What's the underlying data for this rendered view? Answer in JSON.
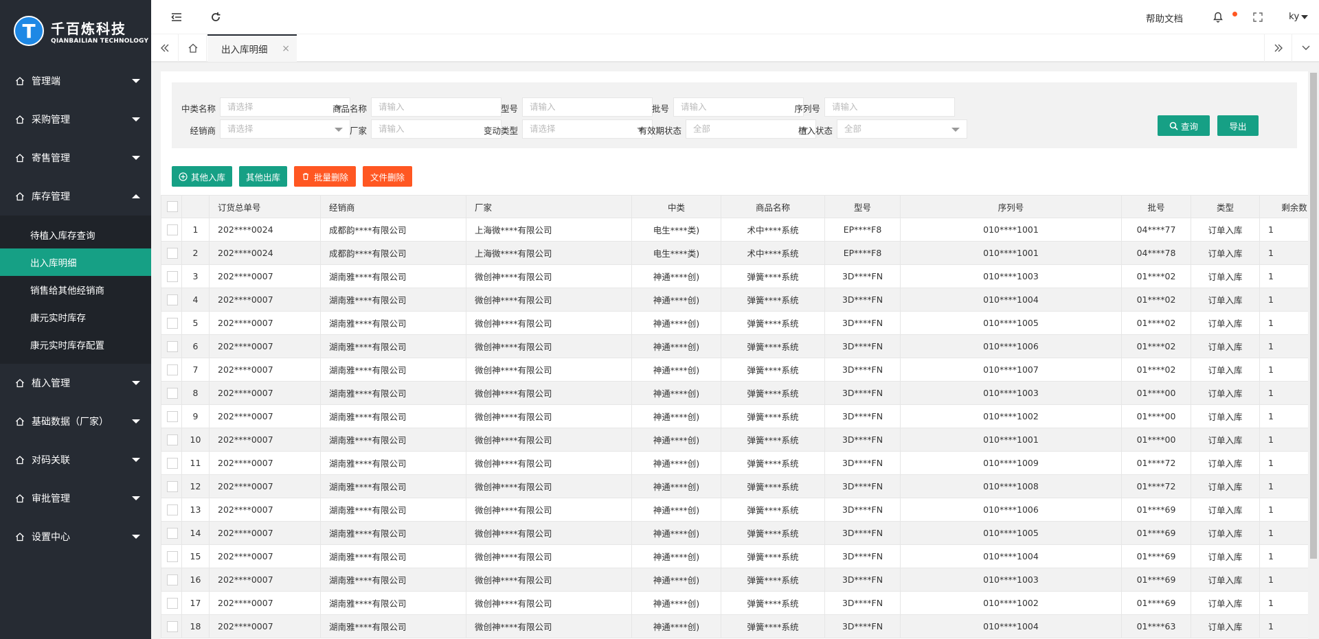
{
  "brand": {
    "logo_char": "T",
    "name_cn": "千百炼科技",
    "name_en": "QIANBAILIAN TECHNOLOGY"
  },
  "sidebar": {
    "items": [
      {
        "label": "管理端",
        "expanded": false
      },
      {
        "label": "采购管理",
        "expanded": false
      },
      {
        "label": "寄售管理",
        "expanded": false
      },
      {
        "label": "库存管理",
        "expanded": true
      },
      {
        "label": "植入管理",
        "expanded": false
      },
      {
        "label": "基础数据（厂家）",
        "expanded": false
      },
      {
        "label": "对码关联",
        "expanded": false
      },
      {
        "label": "审批管理",
        "expanded": false
      },
      {
        "label": "设置中心",
        "expanded": false
      }
    ],
    "submenu": [
      {
        "label": "待植入库存查询",
        "active": false
      },
      {
        "label": "出入库明细",
        "active": true
      },
      {
        "label": "销售给其他经销商",
        "active": false
      },
      {
        "label": "康元实时库存",
        "active": false
      },
      {
        "label": "康元实时库存配置",
        "active": false
      }
    ]
  },
  "header": {
    "help_label": "帮助文档",
    "user": "ky"
  },
  "tabs": {
    "active_label": "出入库明细",
    "close": "×"
  },
  "filters": {
    "row1": [
      {
        "label": "中类名称",
        "placeholder": "请选择",
        "type": "select"
      },
      {
        "label": "商品名称",
        "placeholder": "请输入",
        "type": "input"
      },
      {
        "label": "型号",
        "placeholder": "请输入",
        "type": "input"
      },
      {
        "label": "批号",
        "placeholder": "请输入",
        "type": "input"
      },
      {
        "label": "序列号",
        "placeholder": "请输入",
        "type": "input"
      }
    ],
    "row2": [
      {
        "label": "经销商",
        "placeholder": "请选择",
        "type": "select"
      },
      {
        "label": "厂家",
        "placeholder": "请输入",
        "type": "input"
      },
      {
        "label": "变动类型",
        "placeholder": "请选择",
        "type": "select"
      },
      {
        "label": "有效期状态",
        "placeholder": "全部",
        "type": "select"
      },
      {
        "label": "植入状态",
        "placeholder": "全部",
        "type": "select"
      }
    ],
    "query_label": "查询",
    "export_label": "导出"
  },
  "toolbar": {
    "other_in": "其他入库",
    "other_out": "其他出库",
    "batch_delete": "批量删除",
    "file_delete": "文件删除"
  },
  "table": {
    "columns": [
      "",
      "",
      "订货总单号",
      "经销商",
      "厂家",
      "中类",
      "商品名称",
      "型号",
      "序列号",
      "批号",
      "类型",
      "剩余数"
    ],
    "rows": [
      [
        "1",
        "202****0024",
        "成都韵****有限公司",
        "上海微****有限公司",
        "电生****类)",
        "术中****系统",
        "EP****F8",
        "010****1001",
        "04****77",
        "订单入库",
        "1"
      ],
      [
        "2",
        "202****0024",
        "成都韵****有限公司",
        "上海微****有限公司",
        "电生****类)",
        "术中****系统",
        "EP****F8",
        "010****1001",
        "04****78",
        "订单入库",
        "1"
      ],
      [
        "3",
        "202****0007",
        "湖南雅****有限公司",
        "微创神****有限公司",
        "神通****创)",
        "弹簧****系统",
        "3D****FN",
        "010****1003",
        "01****02",
        "订单入库",
        "1"
      ],
      [
        "4",
        "202****0007",
        "湖南雅****有限公司",
        "微创神****有限公司",
        "神通****创)",
        "弹簧****系统",
        "3D****FN",
        "010****1004",
        "01****02",
        "订单入库",
        "1"
      ],
      [
        "5",
        "202****0007",
        "湖南雅****有限公司",
        "微创神****有限公司",
        "神通****创)",
        "弹簧****系统",
        "3D****FN",
        "010****1005",
        "01****02",
        "订单入库",
        "1"
      ],
      [
        "6",
        "202****0007",
        "湖南雅****有限公司",
        "微创神****有限公司",
        "神通****创)",
        "弹簧****系统",
        "3D****FN",
        "010****1006",
        "01****02",
        "订单入库",
        "1"
      ],
      [
        "7",
        "202****0007",
        "湖南雅****有限公司",
        "微创神****有限公司",
        "神通****创)",
        "弹簧****系统",
        "3D****FN",
        "010****1007",
        "01****02",
        "订单入库",
        "1"
      ],
      [
        "8",
        "202****0007",
        "湖南雅****有限公司",
        "微创神****有限公司",
        "神通****创)",
        "弹簧****系统",
        "3D****FN",
        "010****1003",
        "01****00",
        "订单入库",
        "1"
      ],
      [
        "9",
        "202****0007",
        "湖南雅****有限公司",
        "微创神****有限公司",
        "神通****创)",
        "弹簧****系统",
        "3D****FN",
        "010****1002",
        "01****00",
        "订单入库",
        "1"
      ],
      [
        "10",
        "202****0007",
        "湖南雅****有限公司",
        "微创神****有限公司",
        "神通****创)",
        "弹簧****系统",
        "3D****FN",
        "010****1001",
        "01****00",
        "订单入库",
        "1"
      ],
      [
        "11",
        "202****0007",
        "湖南雅****有限公司",
        "微创神****有限公司",
        "神通****创)",
        "弹簧****系统",
        "3D****FN",
        "010****1009",
        "01****72",
        "订单入库",
        "1"
      ],
      [
        "12",
        "202****0007",
        "湖南雅****有限公司",
        "微创神****有限公司",
        "神通****创)",
        "弹簧****系统",
        "3D****FN",
        "010****1008",
        "01****72",
        "订单入库",
        "1"
      ],
      [
        "13",
        "202****0007",
        "湖南雅****有限公司",
        "微创神****有限公司",
        "神通****创)",
        "弹簧****系统",
        "3D****FN",
        "010****1006",
        "01****69",
        "订单入库",
        "1"
      ],
      [
        "14",
        "202****0007",
        "湖南雅****有限公司",
        "微创神****有限公司",
        "神通****创)",
        "弹簧****系统",
        "3D****FN",
        "010****1005",
        "01****69",
        "订单入库",
        "1"
      ],
      [
        "15",
        "202****0007",
        "湖南雅****有限公司",
        "微创神****有限公司",
        "神通****创)",
        "弹簧****系统",
        "3D****FN",
        "010****1004",
        "01****69",
        "订单入库",
        "1"
      ],
      [
        "16",
        "202****0007",
        "湖南雅****有限公司",
        "微创神****有限公司",
        "神通****创)",
        "弹簧****系统",
        "3D****FN",
        "010****1003",
        "01****69",
        "订单入库",
        "1"
      ],
      [
        "17",
        "202****0007",
        "湖南雅****有限公司",
        "微创神****有限公司",
        "神通****创)",
        "弹簧****系统",
        "3D****FN",
        "010****1002",
        "01****69",
        "订单入库",
        "1"
      ],
      [
        "18",
        "202****0007",
        "湖南雅****有限公司",
        "微创神****有限公司",
        "神通****创)",
        "弹簧****系统",
        "3D****FN",
        "010****1004",
        "01****63",
        "订单入库",
        "1"
      ]
    ]
  },
  "colors": {
    "sidebar_bg": "#262b33",
    "accent": "#16a085",
    "danger": "#ff5722"
  }
}
